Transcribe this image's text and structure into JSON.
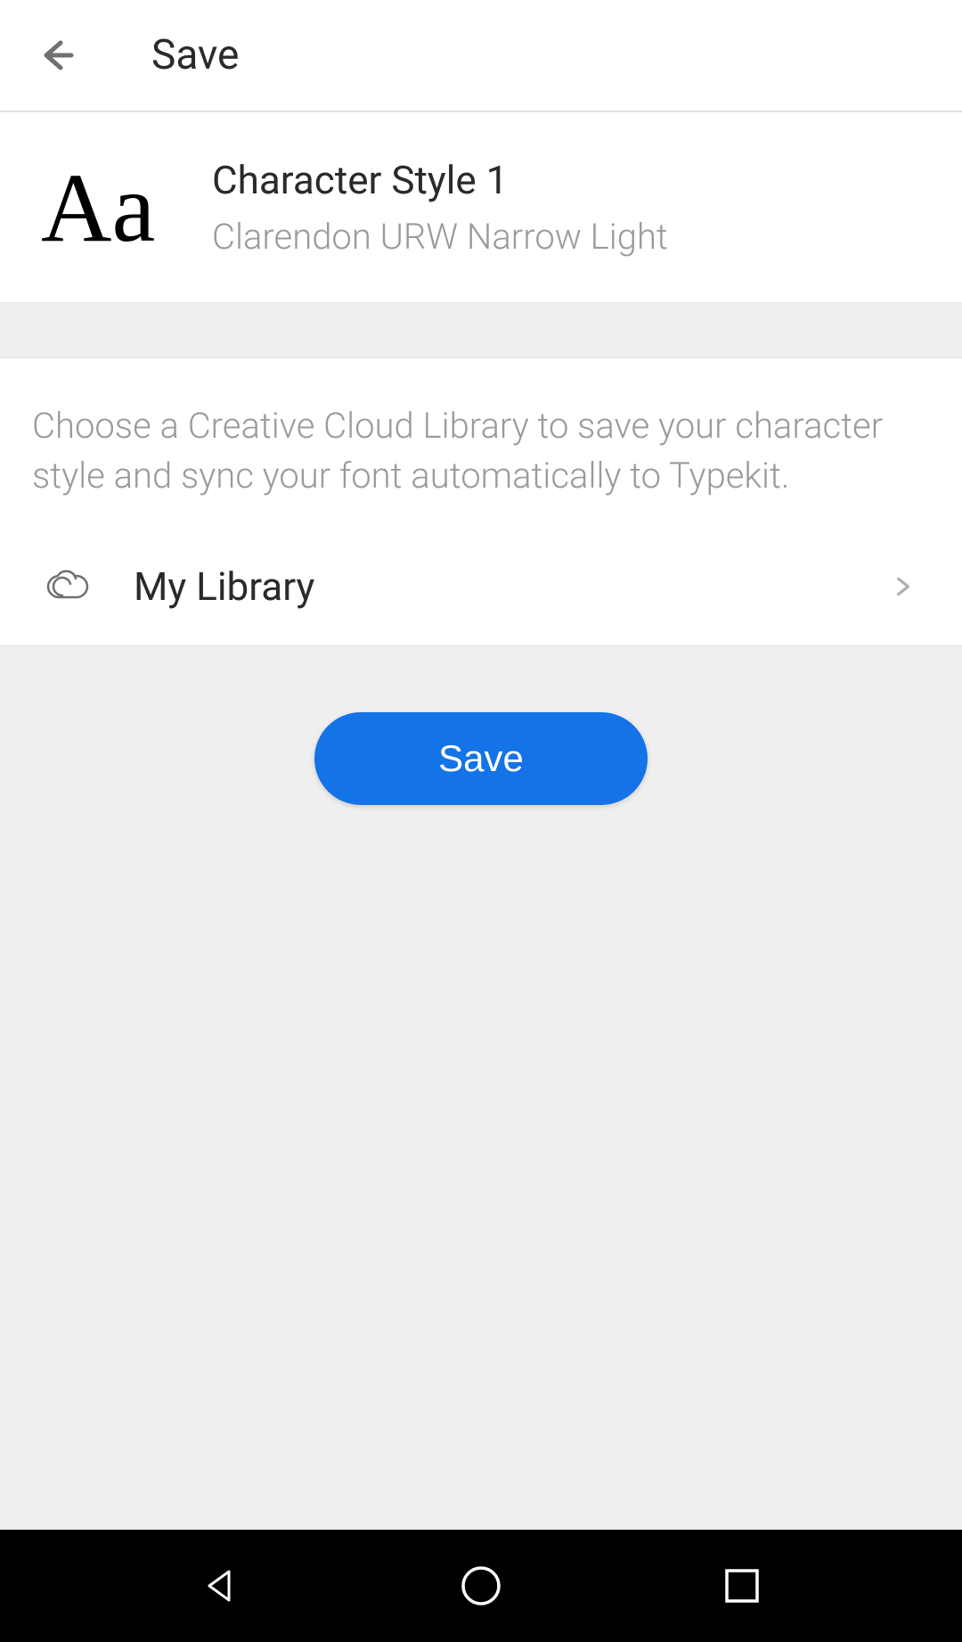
{
  "header": {
    "title": "Save"
  },
  "style": {
    "preview": "Aa",
    "name": "Character Style 1",
    "font": "Clarendon URW Narrow Light"
  },
  "library": {
    "instruction": "Choose a Creative Cloud Library to save your character style and sync your font automatically to Typekit.",
    "selected": "My Library"
  },
  "actions": {
    "save_label": "Save"
  }
}
